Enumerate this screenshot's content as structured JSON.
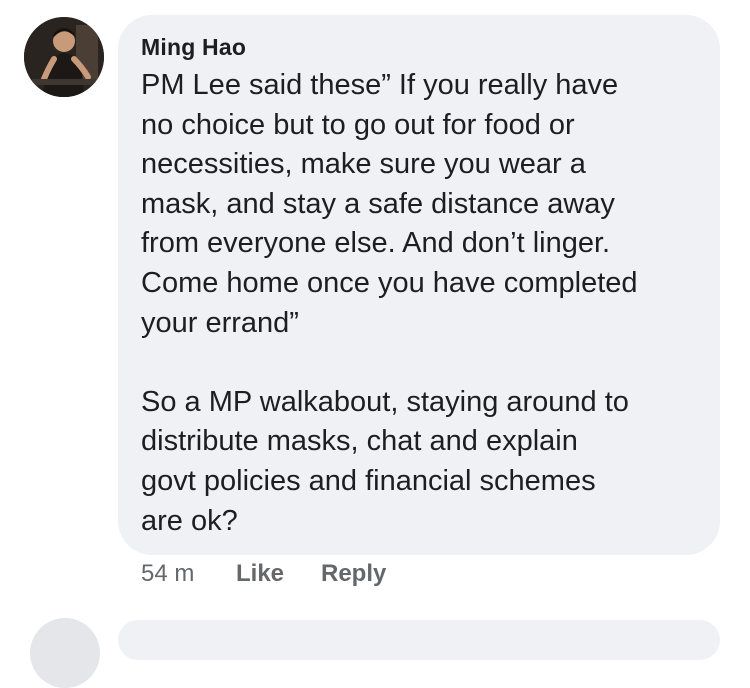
{
  "comment": {
    "author": "Ming Hao",
    "paragraphs": [
      [
        "PM Lee said these” If you really have",
        "no choice but to go out for food or",
        "necessities, make sure you wear a",
        "mask, and stay a safe distance away",
        "from everyone else. And don’t linger.",
        "Come home once you have completed",
        "your errand”"
      ],
      [
        "So a MP walkabout, staying around to",
        "distribute masks, chat and explain",
        "govt policies and financial schemes",
        "are ok?"
      ]
    ],
    "timestamp": "54 m",
    "like_label": "Like",
    "reply_label": "Reply"
  },
  "colors": {
    "bubble": "#eff1f4",
    "text": "#1c1e21",
    "meta": "#65676b"
  }
}
